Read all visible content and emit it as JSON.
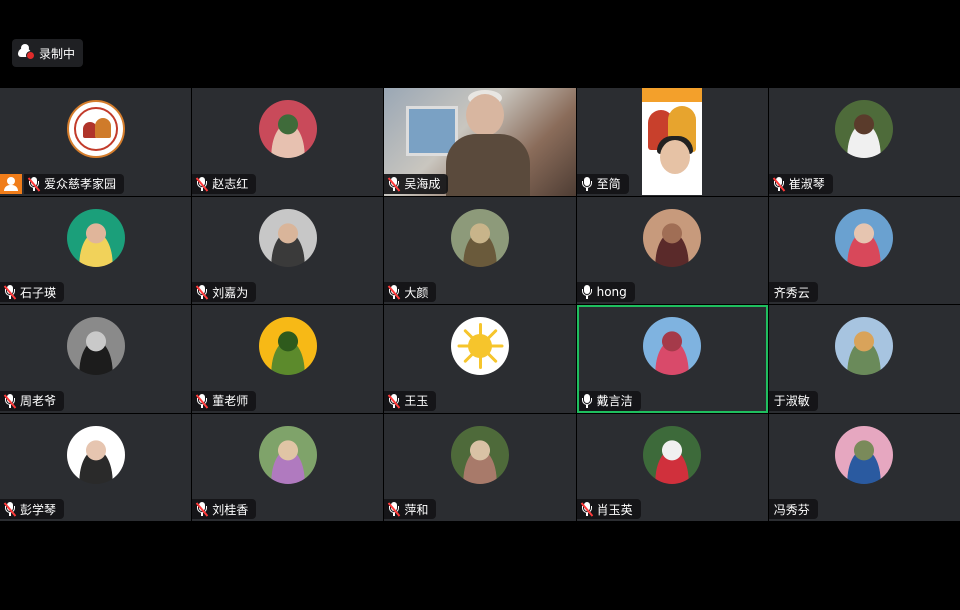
{
  "recording": {
    "label": "录制中"
  },
  "participants": [
    {
      "name": "爱众慈孝家园",
      "mic": "muted",
      "host": true,
      "avatar": "logo"
    },
    {
      "name": "赵志红",
      "mic": "muted",
      "avatar": "photo",
      "colors": [
        "#c94a5a",
        "#e7c1b0",
        "#3f6b3a"
      ]
    },
    {
      "name": "吴海成",
      "mic": "muted",
      "avatar": "video"
    },
    {
      "name": "至简",
      "mic": "on",
      "avatar": "poster"
    },
    {
      "name": "崔淑琴",
      "mic": "muted",
      "avatar": "photo",
      "colors": [
        "#4e6b3a",
        "#f0f0f0",
        "#5a3b2b"
      ]
    },
    {
      "name": "石子瑛",
      "mic": "muted",
      "avatar": "photo",
      "colors": [
        "#1b9f7a",
        "#f1d25a",
        "#e0b59a"
      ]
    },
    {
      "name": "刘嘉为",
      "mic": "muted",
      "avatar": "photo",
      "colors": [
        "#c7c7c7",
        "#3a3a3a",
        "#d9b59a"
      ]
    },
    {
      "name": "大颜",
      "mic": "muted",
      "avatar": "photo",
      "colors": [
        "#8d9a7a",
        "#6a5a3b",
        "#c8b48a"
      ]
    },
    {
      "name": "hong",
      "mic": "on",
      "avatar": "photo",
      "colors": [
        "#c79a7c",
        "#5a2a2a",
        "#a06e55"
      ]
    },
    {
      "name": "齐秀云",
      "mic": "none",
      "avatar": "photo",
      "colors": [
        "#6aa1d0",
        "#d8485a",
        "#e6c5b0"
      ]
    },
    {
      "name": "周老爷",
      "mic": "muted",
      "avatar": "photo",
      "colors": [
        "#8a8a8a",
        "#1c1c1c",
        "#c9c9c9"
      ]
    },
    {
      "name": "董老师",
      "mic": "muted",
      "avatar": "photo",
      "colors": [
        "#f7b916",
        "#5c8a2c",
        "#2e5a1c"
      ]
    },
    {
      "name": "王玉",
      "mic": "muted",
      "avatar": "sun"
    },
    {
      "name": "戴言洁",
      "mic": "on",
      "avatar": "photo",
      "colors": [
        "#7fb3e0",
        "#d94a6a",
        "#a53a4a"
      ],
      "active": true
    },
    {
      "name": "于淑敏",
      "mic": "none",
      "avatar": "photo",
      "colors": [
        "#a7c4e0",
        "#6a8a5a",
        "#d9a35a"
      ]
    },
    {
      "name": "彭学琴",
      "mic": "muted",
      "avatar": "photo",
      "colors": [
        "#ffffff",
        "#2a2a2a",
        "#e6c5b0"
      ]
    },
    {
      "name": "刘桂香",
      "mic": "muted",
      "avatar": "photo",
      "colors": [
        "#7fa36a",
        "#b07abf",
        "#e0c5a5"
      ]
    },
    {
      "name": "萍和",
      "mic": "muted",
      "avatar": "photo",
      "colors": [
        "#4e6a3a",
        "#a87a6a",
        "#d9c2a5"
      ]
    },
    {
      "name": "肖玉英",
      "mic": "muted",
      "avatar": "photo",
      "colors": [
        "#3d6a3a",
        "#d0303c",
        "#f0f0f0"
      ]
    },
    {
      "name": "冯秀芬",
      "mic": "none",
      "avatar": "photo",
      "colors": [
        "#e6a7c0",
        "#2a5aa0",
        "#7a8a5a"
      ]
    }
  ]
}
